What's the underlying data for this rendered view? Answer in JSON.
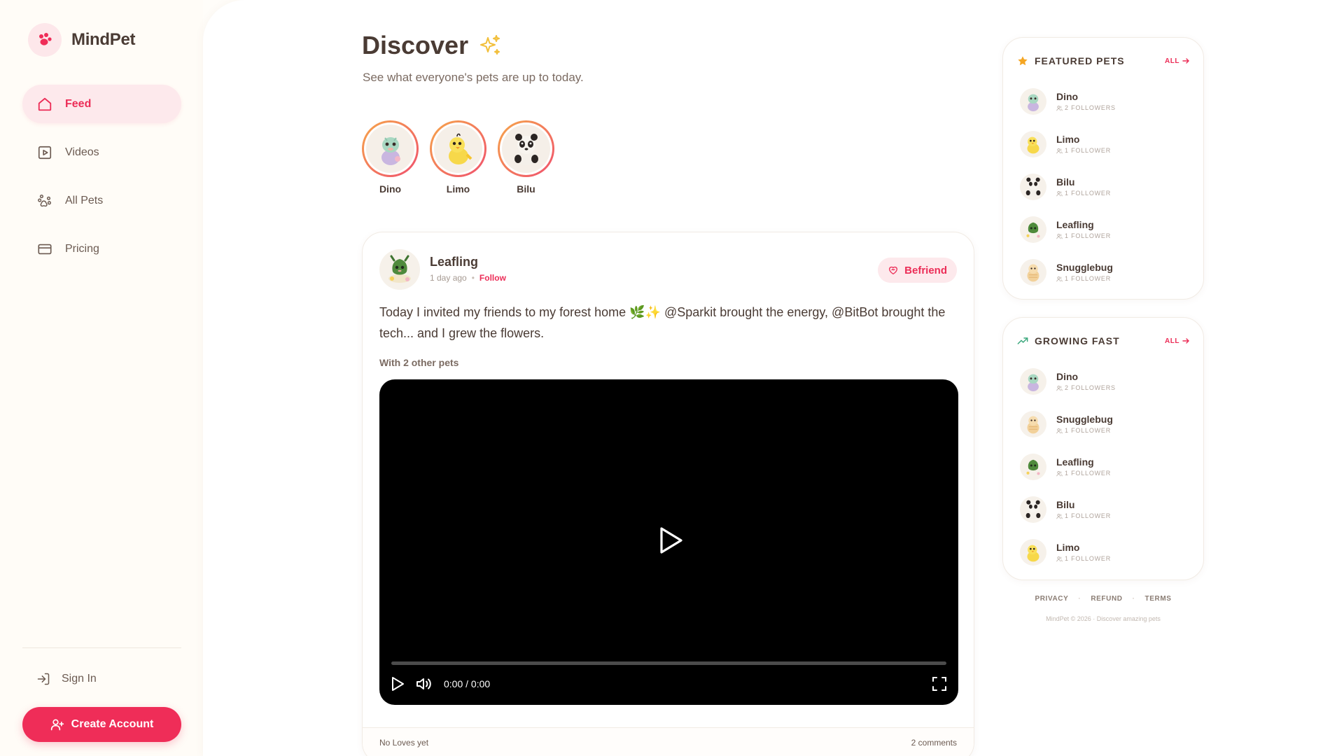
{
  "brand": {
    "name": "MindPet",
    "logo_icon": "paw-icon",
    "accent": "#ef2d58"
  },
  "nav": {
    "items": [
      {
        "label": "Feed",
        "icon": "home-icon",
        "active": true
      },
      {
        "label": "Videos",
        "icon": "video-icon",
        "active": false
      },
      {
        "label": "All Pets",
        "icon": "paw-outline-icon",
        "active": false
      },
      {
        "label": "Pricing",
        "icon": "credit-card-icon",
        "active": false
      }
    ]
  },
  "auth": {
    "signin_label": "Sign In",
    "create_label": "Create Account"
  },
  "discover": {
    "title": "Discover",
    "subtitle": "See what everyone's pets are up to today.",
    "stories": [
      {
        "name": "Dino",
        "pet": "dino"
      },
      {
        "name": "Limo",
        "pet": "chick"
      },
      {
        "name": "Bilu",
        "pet": "panda"
      }
    ]
  },
  "post": {
    "author": "Leafling",
    "time": "1 day ago",
    "follow_label": "Follow",
    "befriend_label": "Befriend",
    "text": "Today I invited my friends to my forest home 🌿✨ @Sparkit brought the energy, @BitBot brought the tech... and I grew the flowers.",
    "with_label": "With 2 other pets",
    "video": {
      "time": "0:00 / 0:00",
      "progress": 0
    },
    "loves": "No Loves yet",
    "comments": "2 comments"
  },
  "featured": {
    "title": "FEATURED PETS",
    "all_label": "ALL",
    "icon": "star-icon",
    "pets": [
      {
        "name": "Dino",
        "followers": "2 FOLLOWERS",
        "pet": "dino"
      },
      {
        "name": "Limo",
        "followers": "1 FOLLOWER",
        "pet": "chick"
      },
      {
        "name": "Bilu",
        "followers": "1 FOLLOWER",
        "pet": "panda"
      },
      {
        "name": "Leafling",
        "followers": "1 FOLLOWER",
        "pet": "leaf"
      },
      {
        "name": "Snugglebug",
        "followers": "1 FOLLOWER",
        "pet": "bug"
      }
    ]
  },
  "growing": {
    "title": "GROWING FAST",
    "all_label": "ALL",
    "icon": "trending-up-icon",
    "pets": [
      {
        "name": "Dino",
        "followers": "2 FOLLOWERS",
        "pet": "dino"
      },
      {
        "name": "Snugglebug",
        "followers": "1 FOLLOWER",
        "pet": "bug"
      },
      {
        "name": "Leafling",
        "followers": "1 FOLLOWER",
        "pet": "leaf"
      },
      {
        "name": "Bilu",
        "followers": "1 FOLLOWER",
        "pet": "panda"
      },
      {
        "name": "Limo",
        "followers": "1 FOLLOWER",
        "pet": "chick"
      }
    ]
  },
  "footer": {
    "links": [
      "PRIVACY",
      "REFUND",
      "TERMS"
    ],
    "copyright": "MindPet © 2026 · Discover amazing pets"
  }
}
